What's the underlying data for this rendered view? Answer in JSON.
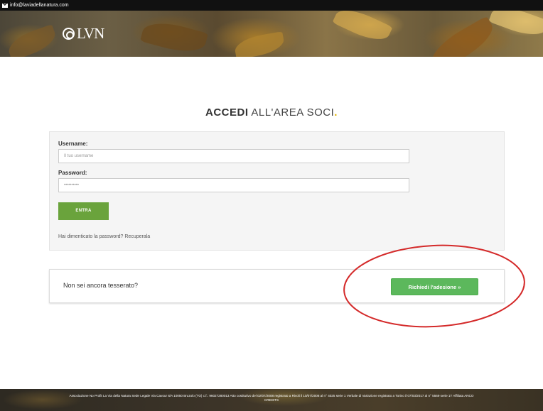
{
  "topbar": {
    "email": "info@laviadellanatura.com",
    "mail_icon": "envelope-icon"
  },
  "brand": {
    "logo_text": "LVN"
  },
  "heading": {
    "bold": "ACCEDI",
    "light": " ALL'AREA SOCI",
    "dot": ".",
    "accent_color": "#e4b400"
  },
  "login": {
    "username_label": "Username:",
    "username_placeholder": "Il tuo username",
    "password_label": "Password:",
    "password_value": "••••••••••",
    "submit_label": "ENTRA",
    "forgot_text": "Hai dimenticato la password? Recuperala",
    "button_color": "#6aa33c"
  },
  "join": {
    "question": "Non sei ancora tesserato?",
    "button_label": "Richiedi l'adesione »",
    "button_color": "#5cb85c",
    "annotation_color": "#d42a2a"
  },
  "footer": {
    "legal": "Associazione No Profit La Via della Natura Sede Legale Via Cavour 8/A 10050 Bruzolo (TO) c.f.: 96027280013 Atto costitutivo del 02/07/2008 registrato a Rivoli il 10/07/2008 al n° 4025 serie 1 Verbale di Variazione registrato a Torino il 07/03/2017 al n° 5569 serie 1T Affiliata ANCO",
    "credits": "CREDITS"
  }
}
